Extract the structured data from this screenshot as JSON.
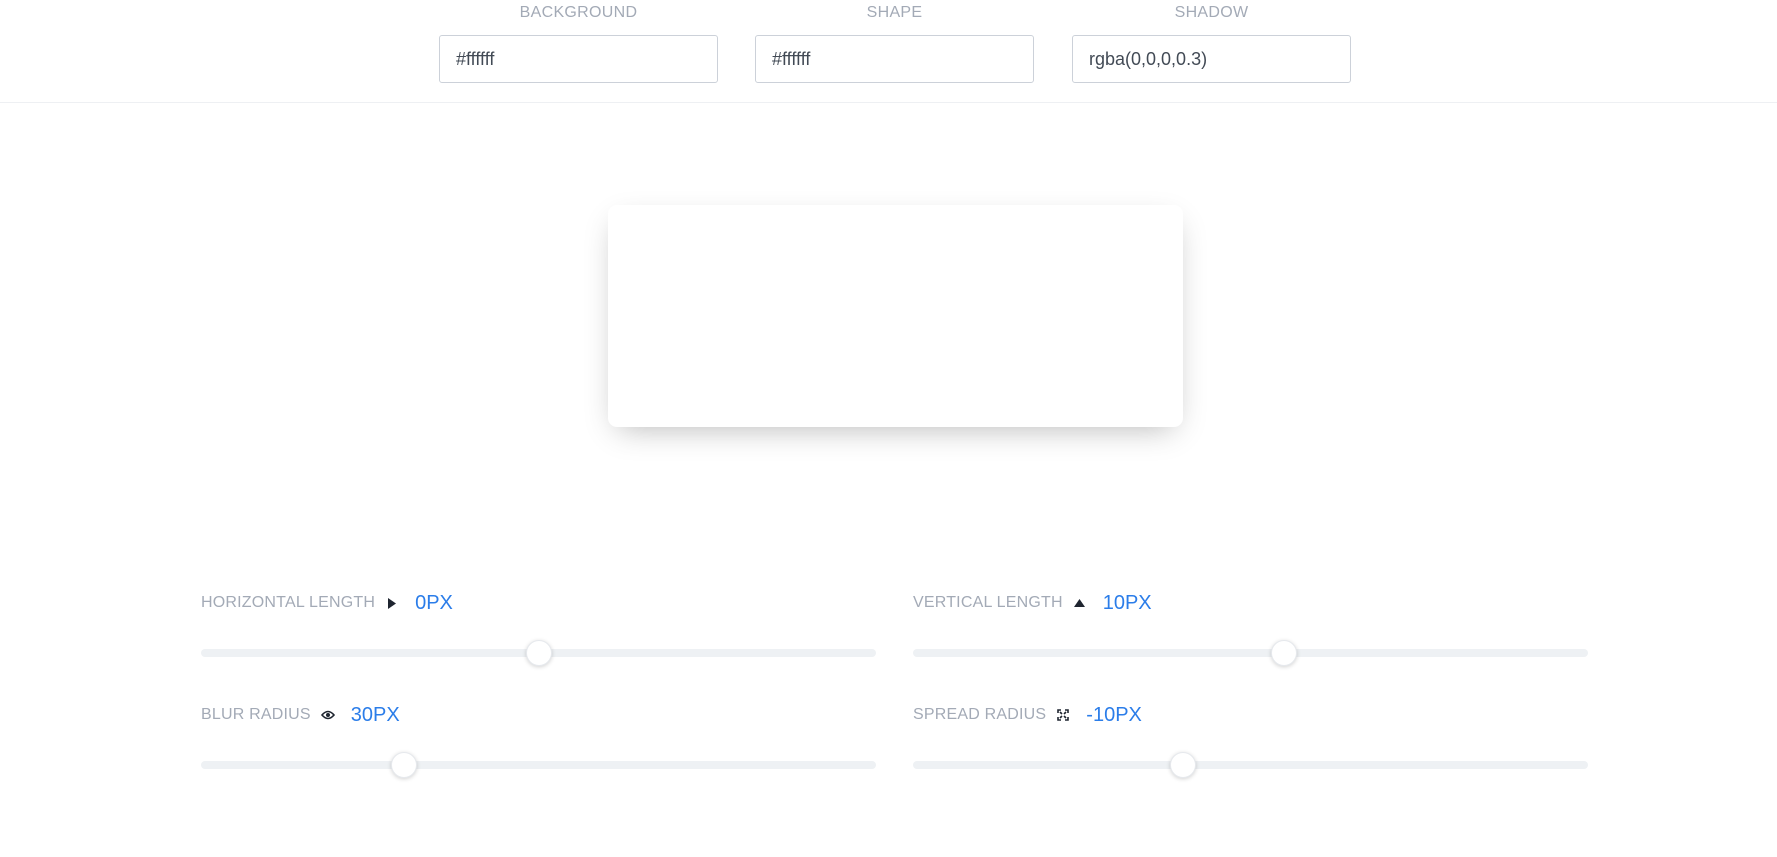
{
  "colors": {
    "accent": "#2b7de9",
    "label": "#a3aab6",
    "track": "#eef1f4"
  },
  "inputs": {
    "background": {
      "label": "BACKGROUND",
      "value": "#ffffff"
    },
    "shape": {
      "label": "SHAPE",
      "value": "#ffffff"
    },
    "shadow": {
      "label": "SHADOW",
      "value": "rgba(0,0,0,0.3)"
    }
  },
  "controls": {
    "horizontal": {
      "label": "HORIZONTAL LENGTH",
      "value_text": "0PX",
      "icon": "caret-right-icon",
      "value": 0,
      "min": -100,
      "max": 100
    },
    "vertical": {
      "label": "VERTICAL LENGTH",
      "value_text": "10PX",
      "icon": "caret-up-icon",
      "value": 10,
      "min": -100,
      "max": 100
    },
    "blur": {
      "label": "BLUR RADIUS",
      "value_text": "30PX",
      "icon": "eye-icon",
      "value": 30,
      "min": 0,
      "max": 100
    },
    "spread": {
      "label": "SPREAD RADIUS",
      "value_text": "-10PX",
      "icon": "expand-icon",
      "value": -10,
      "min": -50,
      "max": 50
    }
  }
}
